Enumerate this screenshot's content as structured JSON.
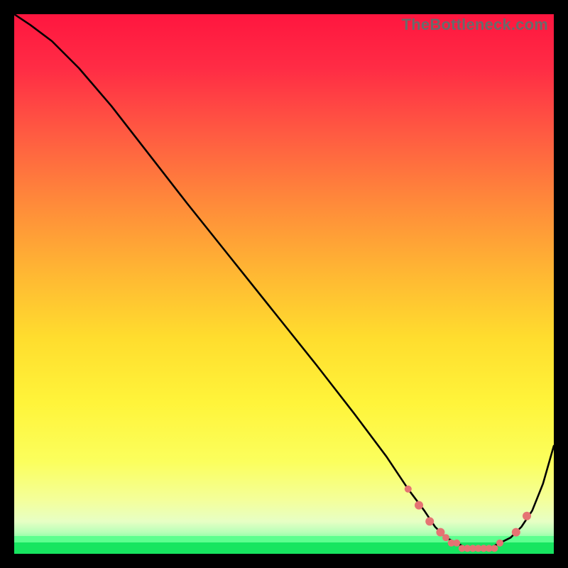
{
  "watermark": "TheBottleneck.com",
  "colors": {
    "curve": "#000000",
    "marker": "#e57373"
  },
  "chart_data": {
    "type": "line",
    "title": "",
    "xlabel": "",
    "ylabel": "",
    "xlim": [
      0,
      100
    ],
    "ylim": [
      0,
      100
    ],
    "annotations": [],
    "series": [
      {
        "name": "curve",
        "x": [
          0,
          3,
          7,
          12,
          18,
          25,
          32,
          40,
          48,
          56,
          63,
          69,
          73,
          76,
          78,
          80,
          82,
          84,
          86,
          88,
          90,
          92,
          94,
          96,
          98,
          100
        ],
        "y": [
          100,
          98,
          95,
          90,
          83,
          74,
          65,
          55,
          45,
          35,
          26,
          18,
          12,
          8,
          5,
          3,
          2,
          1,
          1,
          1,
          2,
          3,
          5,
          8,
          13,
          20
        ]
      }
    ],
    "markers": {
      "series": "curve",
      "x": [
        73,
        75,
        77,
        79,
        80,
        81,
        82,
        83,
        84,
        85,
        86,
        87,
        88,
        89,
        90,
        93,
        95
      ],
      "y": [
        12,
        9,
        6,
        4,
        3,
        2,
        2,
        1,
        1,
        1,
        1,
        1,
        1,
        1,
        2,
        4,
        7
      ],
      "r": [
        5,
        6,
        6,
        6,
        5,
        5,
        5,
        5,
        5,
        5,
        5,
        5,
        5,
        5,
        5,
        6,
        6
      ]
    }
  }
}
